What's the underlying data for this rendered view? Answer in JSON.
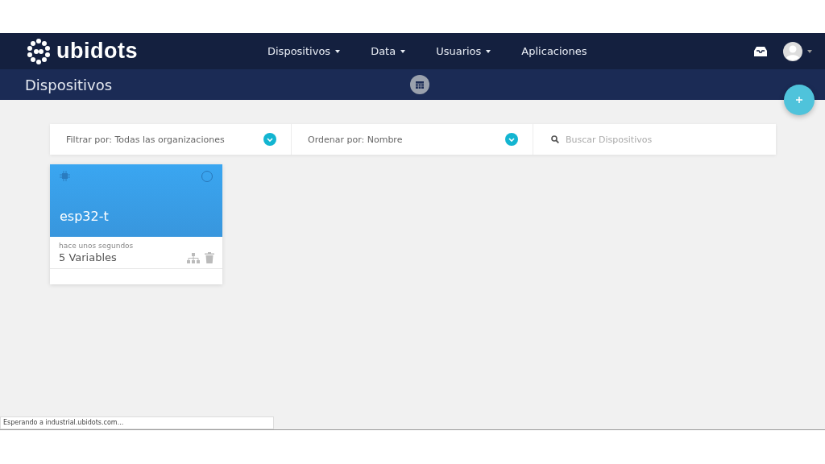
{
  "navbar": {
    "logo": "ubidots",
    "menu": [
      {
        "label": "Dispositivos",
        "dropdown": true
      },
      {
        "label": "Data",
        "dropdown": true
      },
      {
        "label": "Usuarios",
        "dropdown": true
      },
      {
        "label": "Aplicaciones",
        "dropdown": false
      }
    ]
  },
  "subheader": {
    "title": "Dispositivos"
  },
  "toolbar": {
    "filter": "Filtrar por: Todas las organizaciones",
    "sort": "Ordenar por: Nombre",
    "search": {
      "placeholder": "Buscar Dispositivos"
    }
  },
  "devices": [
    {
      "name": "esp32-t",
      "last_activity": "hace unos segundos",
      "variables": "5 Variables",
      "selected": false
    }
  ],
  "status_bar": "Esperando a industrial.ubidots.com..."
}
